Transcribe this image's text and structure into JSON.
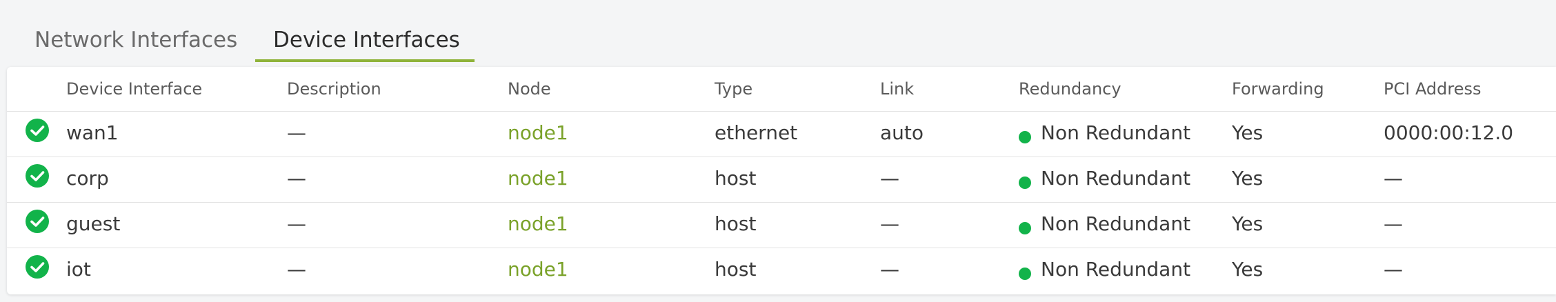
{
  "tabs": [
    {
      "label": "Network Interfaces",
      "active": false
    },
    {
      "label": "Device Interfaces",
      "active": true
    }
  ],
  "table": {
    "columns": [
      "Device Interface",
      "Description",
      "Node",
      "Type",
      "Link",
      "Redundancy",
      "Forwarding",
      "PCI Address"
    ],
    "rows": [
      {
        "status": "ok",
        "name": "wan1",
        "description": "—",
        "node": "node1",
        "type": "ethernet",
        "link": "auto",
        "redundancy": "Non Redundant",
        "forwarding": "Yes",
        "pci": "0000:00:12.0"
      },
      {
        "status": "ok",
        "name": "corp",
        "description": "—",
        "node": "node1",
        "type": "host",
        "link": "—",
        "redundancy": "Non Redundant",
        "forwarding": "Yes",
        "pci": "—"
      },
      {
        "status": "ok",
        "name": "guest",
        "description": "—",
        "node": "node1",
        "type": "host",
        "link": "—",
        "redundancy": "Non Redundant",
        "forwarding": "Yes",
        "pci": "—"
      },
      {
        "status": "ok",
        "name": "iot",
        "description": "—",
        "node": "node1",
        "type": "host",
        "link": "—",
        "redundancy": "Non Redundant",
        "forwarding": "Yes",
        "pci": "—"
      }
    ]
  },
  "colors": {
    "accent": "#8fb339",
    "link": "#7aa22a",
    "status_ok": "#12b34a"
  },
  "icons": {
    "status": "check-circle-icon",
    "redundancy": "status-dot-icon"
  }
}
